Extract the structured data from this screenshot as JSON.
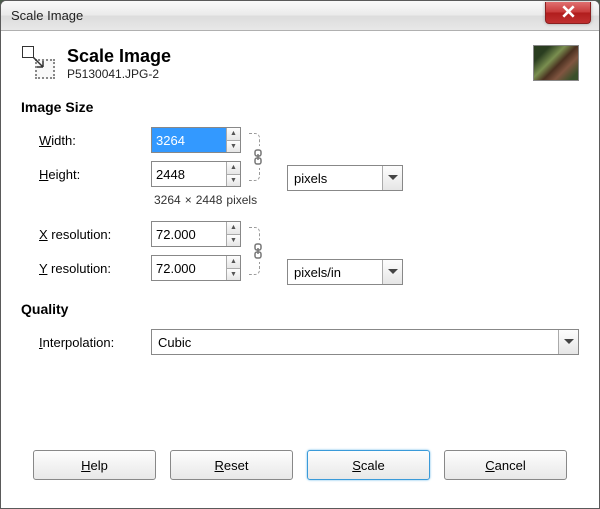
{
  "window_title": "Scale Image",
  "header": {
    "title": "Scale Image",
    "subtitle": "P5130041.JPG-2"
  },
  "sections": {
    "image_size_label": "Image Size",
    "quality_label": "Quality"
  },
  "labels": {
    "width": "idth:",
    "height": "eight:",
    "x_res": " resolution:",
    "y_res": " resolution:",
    "interpolation": "nterpolation:"
  },
  "values": {
    "width": "3264",
    "height": "2448",
    "x_res": "72.000",
    "y_res": "72.000",
    "interpolation": "Cubic"
  },
  "units": {
    "size": "pixels",
    "res": "pixels/in"
  },
  "dims_readout": {
    "w": "3264",
    "sep": "×",
    "h": "2448",
    "u": "pixels"
  },
  "buttons": {
    "help": "elp",
    "reset": "eset",
    "scale": "cale",
    "cancel": "ancel"
  }
}
